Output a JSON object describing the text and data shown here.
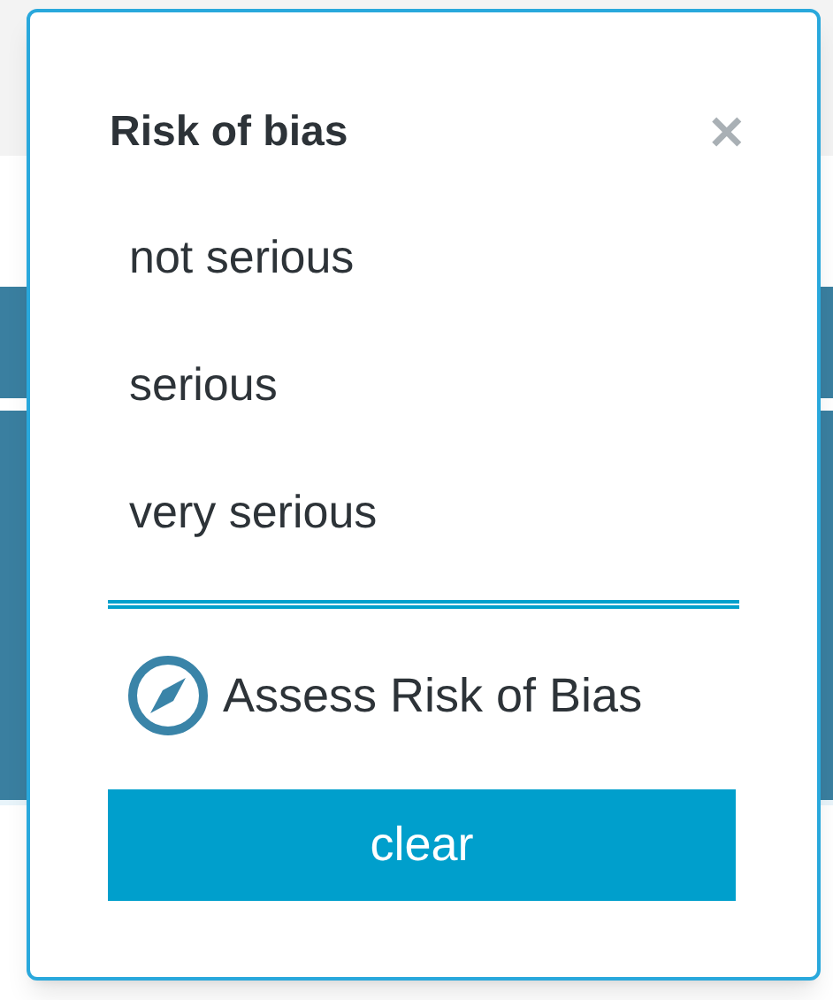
{
  "popup": {
    "title": "Risk of bias",
    "close": "✕",
    "options": [
      {
        "label": "not serious",
        "selected": false
      },
      {
        "label": "serious",
        "selected": false
      },
      {
        "label": "very serious",
        "selected": false
      }
    ],
    "assess_link": "Assess Risk of Bias",
    "clear_button": "clear"
  }
}
